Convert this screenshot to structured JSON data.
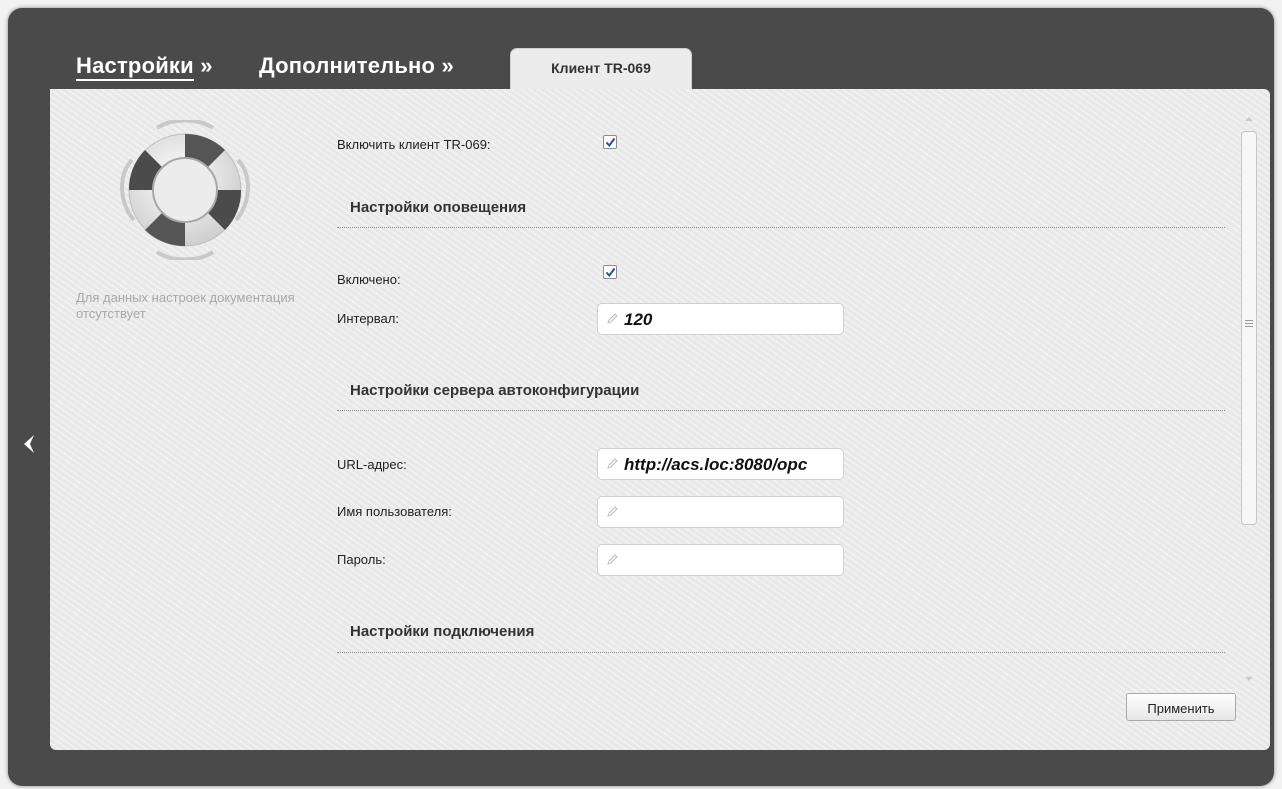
{
  "breadcrumb": {
    "level1": "Настройки",
    "level2": "Дополнительно",
    "separator": "»"
  },
  "tab": {
    "label": "Клиент TR-069"
  },
  "side_note": "Для данных настроек документация отсутствует",
  "form": {
    "enable_client": {
      "label": "Включить клиент TR-069:",
      "checked": true
    },
    "notify_section": {
      "title": "Настройки оповещения"
    },
    "enabled": {
      "label": "Включено:",
      "checked": true
    },
    "interval": {
      "label": "Интервал:",
      "value": "120"
    },
    "acs_section": {
      "title": "Настройки сервера автоконфигурации"
    },
    "url": {
      "label": "URL-адрес:",
      "value": "http://acs.loc:8080/opc"
    },
    "username": {
      "label": "Имя пользователя:",
      "value": ""
    },
    "password": {
      "label": "Пароль:",
      "value": ""
    },
    "connection_section": {
      "title": "Настройки подключения"
    }
  },
  "apply_button": {
    "label": "Применить"
  },
  "icons": {
    "back": "chevron-left-icon",
    "help": "lifebuoy-icon",
    "edit": "pencil-icon",
    "check": "checkmark-icon"
  },
  "colors": {
    "frame": "#4a4a4a",
    "content_bg": "#ececec",
    "checkmark": "#2a4f8f"
  }
}
